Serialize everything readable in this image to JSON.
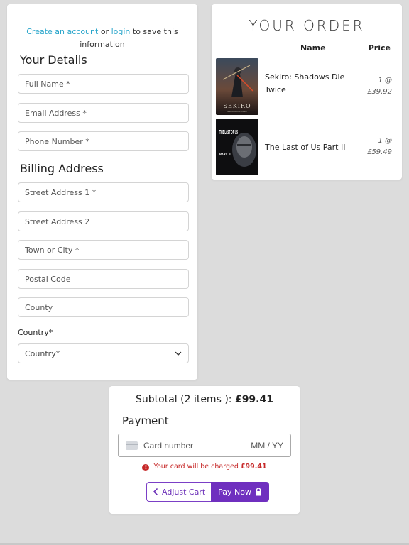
{
  "account_note": {
    "create_link": "Create an account",
    "or_text": "or",
    "login_link": "login",
    "suffix": "to save this information"
  },
  "details": {
    "title": "Your Details",
    "full_name_placeholder": "Full Name *",
    "email_placeholder": "Email Address *",
    "phone_placeholder": "Phone Number *"
  },
  "billing": {
    "title": "Billing Address",
    "street1_placeholder": "Street Address 1 *",
    "street2_placeholder": "Street Address 2",
    "town_placeholder": "Town or City *",
    "postal_placeholder": "Postal Code",
    "county_placeholder": "County",
    "country_label": "Country*",
    "country_selected": "Country*"
  },
  "order": {
    "title": "YOUR ORDER",
    "col_name": "Name",
    "col_price": "Price",
    "items": [
      {
        "name": "Sekiro: Shadows Die Twice",
        "qty": "1 @",
        "price": "£39.92",
        "cover_text": "SEKIRO",
        "cover_sub": "SHADOWS DIE TWICE"
      },
      {
        "name": "The Last of Us Part II",
        "qty": "1 @",
        "price": "£59.49",
        "cover_text": "THE LAST OF US",
        "cover_sub": "PART II"
      }
    ]
  },
  "payment": {
    "subtotal_label": "Subtotal (2 items ):",
    "subtotal_value": "£99.41",
    "title": "Payment",
    "card_placeholder": "Card number",
    "expiry_placeholder": "MM / YY",
    "charge_prefix": "Your card will be charged",
    "charge_amount": "£99.41",
    "adjust_label": "Adjust Cart",
    "pay_label": "Pay Now"
  },
  "colors": {
    "link": "#2ba6cb",
    "accent": "#6f2fbf",
    "error": "#c62828",
    "page_bg": "#dcdcdc"
  }
}
